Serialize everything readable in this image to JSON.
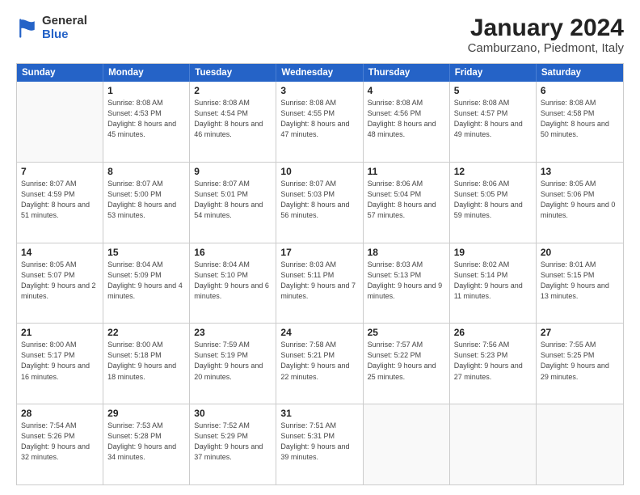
{
  "header": {
    "logo_general": "General",
    "logo_blue": "Blue",
    "title": "January 2024",
    "subtitle": "Camburzano, Piedmont, Italy"
  },
  "calendar": {
    "days_of_week": [
      "Sunday",
      "Monday",
      "Tuesday",
      "Wednesday",
      "Thursday",
      "Friday",
      "Saturday"
    ],
    "weeks": [
      {
        "cells": [
          {
            "empty": true
          },
          {
            "day": "1",
            "sunrise": "8:08 AM",
            "sunset": "4:53 PM",
            "daylight": "8 hours and 45 minutes."
          },
          {
            "day": "2",
            "sunrise": "8:08 AM",
            "sunset": "4:54 PM",
            "daylight": "8 hours and 46 minutes."
          },
          {
            "day": "3",
            "sunrise": "8:08 AM",
            "sunset": "4:55 PM",
            "daylight": "8 hours and 47 minutes."
          },
          {
            "day": "4",
            "sunrise": "8:08 AM",
            "sunset": "4:56 PM",
            "daylight": "8 hours and 48 minutes."
          },
          {
            "day": "5",
            "sunrise": "8:08 AM",
            "sunset": "4:57 PM",
            "daylight": "8 hours and 49 minutes."
          },
          {
            "day": "6",
            "sunrise": "8:08 AM",
            "sunset": "4:58 PM",
            "daylight": "8 hours and 50 minutes."
          }
        ]
      },
      {
        "cells": [
          {
            "day": "7",
            "sunrise": "8:07 AM",
            "sunset": "4:59 PM",
            "daylight": "8 hours and 51 minutes."
          },
          {
            "day": "8",
            "sunrise": "8:07 AM",
            "sunset": "5:00 PM",
            "daylight": "8 hours and 53 minutes."
          },
          {
            "day": "9",
            "sunrise": "8:07 AM",
            "sunset": "5:01 PM",
            "daylight": "8 hours and 54 minutes."
          },
          {
            "day": "10",
            "sunrise": "8:07 AM",
            "sunset": "5:03 PM",
            "daylight": "8 hours and 56 minutes."
          },
          {
            "day": "11",
            "sunrise": "8:06 AM",
            "sunset": "5:04 PM",
            "daylight": "8 hours and 57 minutes."
          },
          {
            "day": "12",
            "sunrise": "8:06 AM",
            "sunset": "5:05 PM",
            "daylight": "8 hours and 59 minutes."
          },
          {
            "day": "13",
            "sunrise": "8:05 AM",
            "sunset": "5:06 PM",
            "daylight": "9 hours and 0 minutes."
          }
        ]
      },
      {
        "cells": [
          {
            "day": "14",
            "sunrise": "8:05 AM",
            "sunset": "5:07 PM",
            "daylight": "9 hours and 2 minutes."
          },
          {
            "day": "15",
            "sunrise": "8:04 AM",
            "sunset": "5:09 PM",
            "daylight": "9 hours and 4 minutes."
          },
          {
            "day": "16",
            "sunrise": "8:04 AM",
            "sunset": "5:10 PM",
            "daylight": "9 hours and 6 minutes."
          },
          {
            "day": "17",
            "sunrise": "8:03 AM",
            "sunset": "5:11 PM",
            "daylight": "9 hours and 7 minutes."
          },
          {
            "day": "18",
            "sunrise": "8:03 AM",
            "sunset": "5:13 PM",
            "daylight": "9 hours and 9 minutes."
          },
          {
            "day": "19",
            "sunrise": "8:02 AM",
            "sunset": "5:14 PM",
            "daylight": "9 hours and 11 minutes."
          },
          {
            "day": "20",
            "sunrise": "8:01 AM",
            "sunset": "5:15 PM",
            "daylight": "9 hours and 13 minutes."
          }
        ]
      },
      {
        "cells": [
          {
            "day": "21",
            "sunrise": "8:00 AM",
            "sunset": "5:17 PM",
            "daylight": "9 hours and 16 minutes."
          },
          {
            "day": "22",
            "sunrise": "8:00 AM",
            "sunset": "5:18 PM",
            "daylight": "9 hours and 18 minutes."
          },
          {
            "day": "23",
            "sunrise": "7:59 AM",
            "sunset": "5:19 PM",
            "daylight": "9 hours and 20 minutes."
          },
          {
            "day": "24",
            "sunrise": "7:58 AM",
            "sunset": "5:21 PM",
            "daylight": "9 hours and 22 minutes."
          },
          {
            "day": "25",
            "sunrise": "7:57 AM",
            "sunset": "5:22 PM",
            "daylight": "9 hours and 25 minutes."
          },
          {
            "day": "26",
            "sunrise": "7:56 AM",
            "sunset": "5:23 PM",
            "daylight": "9 hours and 27 minutes."
          },
          {
            "day": "27",
            "sunrise": "7:55 AM",
            "sunset": "5:25 PM",
            "daylight": "9 hours and 29 minutes."
          }
        ]
      },
      {
        "cells": [
          {
            "day": "28",
            "sunrise": "7:54 AM",
            "sunset": "5:26 PM",
            "daylight": "9 hours and 32 minutes."
          },
          {
            "day": "29",
            "sunrise": "7:53 AM",
            "sunset": "5:28 PM",
            "daylight": "9 hours and 34 minutes."
          },
          {
            "day": "30",
            "sunrise": "7:52 AM",
            "sunset": "5:29 PM",
            "daylight": "9 hours and 37 minutes."
          },
          {
            "day": "31",
            "sunrise": "7:51 AM",
            "sunset": "5:31 PM",
            "daylight": "9 hours and 39 minutes."
          },
          {
            "empty": true
          },
          {
            "empty": true
          },
          {
            "empty": true
          }
        ]
      }
    ]
  },
  "labels": {
    "sunrise": "Sunrise: ",
    "sunset": "Sunset: ",
    "daylight": "Daylight: "
  }
}
